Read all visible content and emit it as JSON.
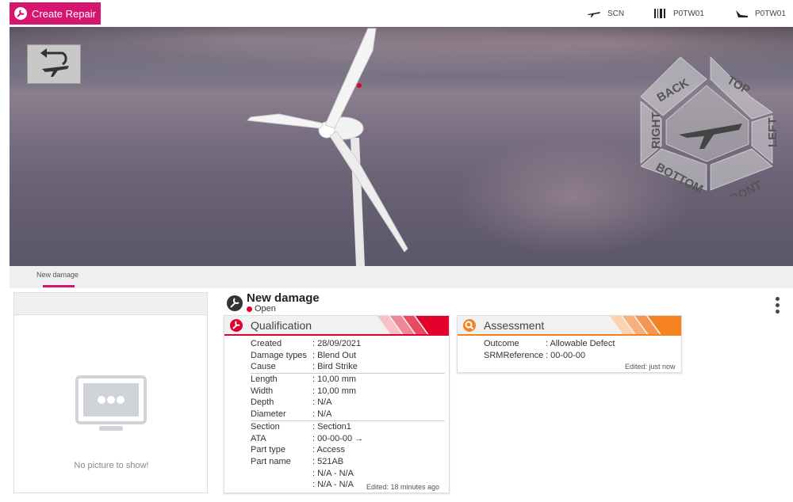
{
  "toolbar": {
    "create_repair_label": "Create Repair",
    "aircraft_type": "SCN",
    "serial": "P0TW01",
    "registration": "P0TW01"
  },
  "viewer": {
    "cube_labels": {
      "back": "BACK",
      "top": "TOP",
      "left": "LEFT",
      "right": "RIGHT",
      "bottom": "BOTTOM",
      "front": "FRONT"
    }
  },
  "tabs": [
    {
      "label": "New damage",
      "active": true
    }
  ],
  "picture_panel": {
    "empty_text": "No picture to show!"
  },
  "damage": {
    "title": "New damage",
    "status": "Open",
    "status_color": "#e3002b"
  },
  "qualification": {
    "title": "Qualification",
    "accent": "#e3002b",
    "group1": [
      {
        "key": "Created",
        "value": ": 28/09/2021"
      },
      {
        "key": "Damage types",
        "value": ": Blend Out"
      },
      {
        "key": "Cause",
        "value": ": Bird Strike"
      }
    ],
    "group2": [
      {
        "key": "Length",
        "value": ": 10,00 mm"
      },
      {
        "key": "Width",
        "value": ": 10,00 mm"
      },
      {
        "key": "Depth",
        "value": ": N/A"
      },
      {
        "key": "Diameter",
        "value": ": N/A"
      }
    ],
    "group3": [
      {
        "key": "Section",
        "value": ": Section1"
      },
      {
        "key": "ATA",
        "value": ": 00-00-00 →"
      },
      {
        "key": "Part type",
        "value": ": Access"
      },
      {
        "key": "Part name",
        "value": ": 521AB"
      },
      {
        "key": "",
        "value": ": N/A - N/A"
      },
      {
        "key": "",
        "value": ": N/A - N/A"
      }
    ],
    "edited": "Edited: 18 minutes ago"
  },
  "assessment": {
    "title": "Assessment",
    "accent": "#f58220",
    "rows": [
      {
        "key": "Outcome",
        "value": ": Allowable Defect"
      },
      {
        "key": "SRMReference",
        "value": ": 00-00-00"
      }
    ],
    "edited": "Edited: just now"
  },
  "icons": {
    "create": "wrench-plus-icon",
    "aircraft": "airplane-icon",
    "serial": "barcode-icon",
    "registration": "plane-tail-icon",
    "back": "rotate-back-icon",
    "monitor": "monitor-icon",
    "qualification": "wrench-circle-icon",
    "assessment": "search-circle-icon",
    "menu": "kebab-menu-icon"
  }
}
